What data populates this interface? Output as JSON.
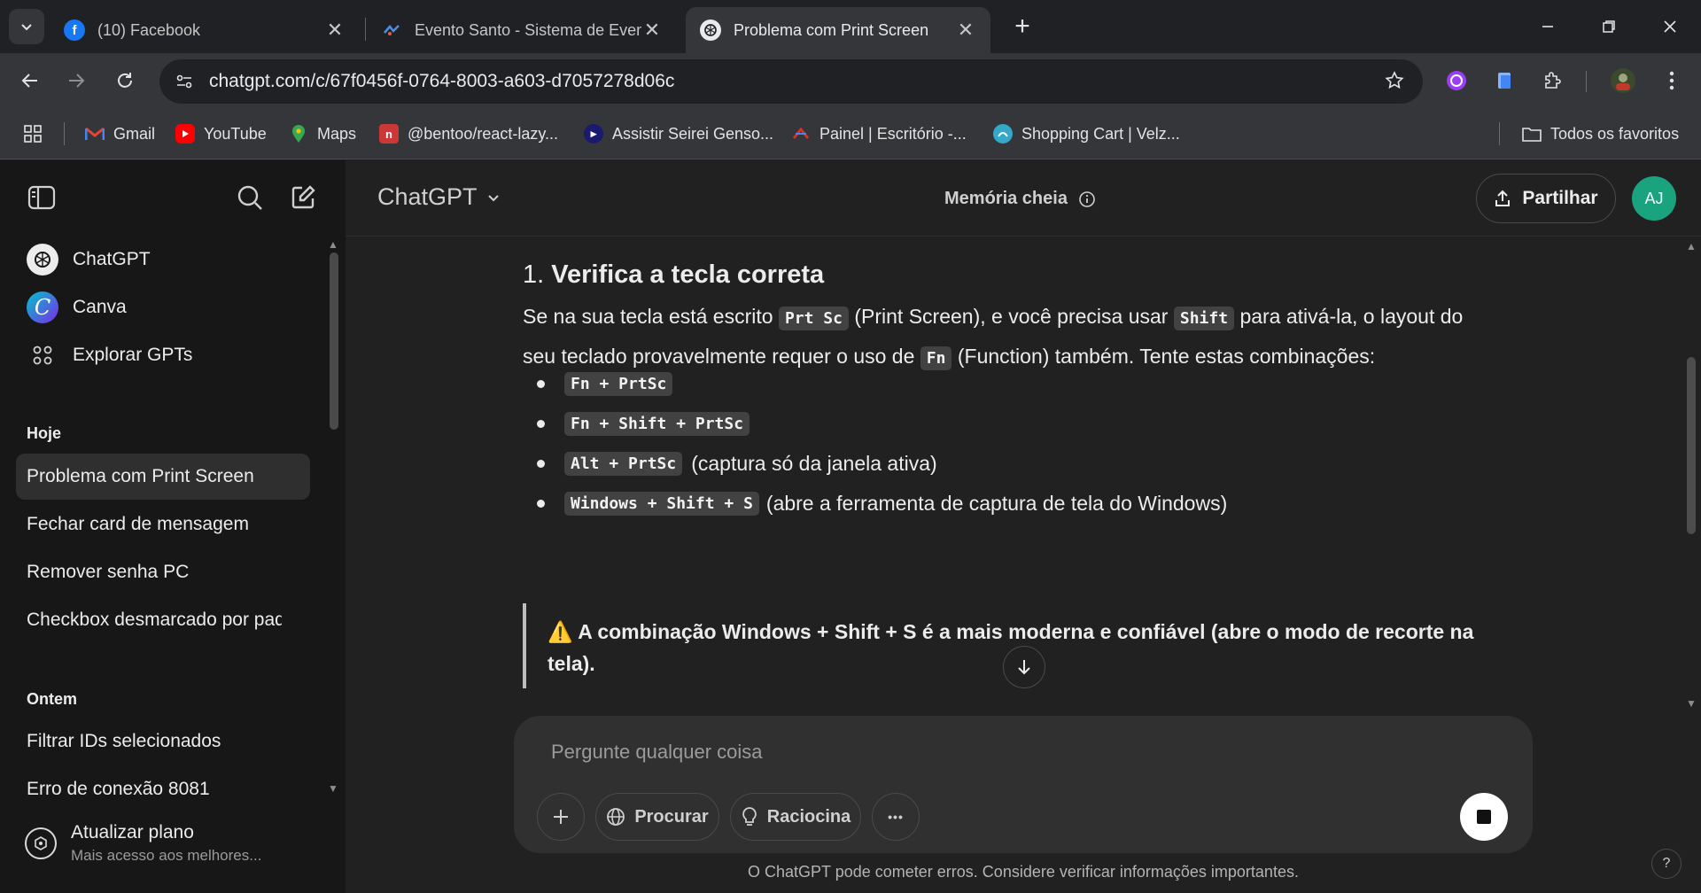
{
  "browser": {
    "tabs": [
      {
        "title": "(10) Facebook",
        "close": "✕"
      },
      {
        "title": "Evento Santo - Sistema de Even",
        "close": "✕"
      },
      {
        "title": "Problema com Print Screen",
        "close": "✕"
      }
    ],
    "new_tab": "+",
    "url": "chatgpt.com/c/67f0456f-0764-8003-a603-d7057278d06c",
    "bookmarks": [
      {
        "label": "Gmail",
        "icon": "gmail-icon",
        "color": "#ea4335"
      },
      {
        "label": "YouTube",
        "icon": "youtube-icon",
        "color": "#ff0000"
      },
      {
        "label": "Maps",
        "icon": "maps-icon",
        "color": "#34a853"
      },
      {
        "label": "@bentoo/react-lazy...",
        "icon": "npm-icon",
        "color": "#cb3837"
      },
      {
        "label": "Assistir Seirei Genso...",
        "icon": "anime-icon",
        "color": "#1a1a6e"
      },
      {
        "label": "Painel | Escritório -...",
        "icon": "painel-icon",
        "color": "#d93025"
      },
      {
        "label": "Shopping Cart | Velz...",
        "icon": "cart-icon",
        "color": "#4285f4"
      }
    ],
    "all_bookmarks": "Todos os favoritos"
  },
  "sidebar": {
    "items": [
      {
        "label": "ChatGPT",
        "icon": "openai-logo-icon"
      },
      {
        "label": "Canva",
        "icon": "canva-logo-icon"
      },
      {
        "label": "Explorar GPTs",
        "icon": "grid-icon"
      }
    ],
    "today_label": "Hoje",
    "today": [
      "Problema com Print Screen",
      "Fechar card de mensagem",
      "Remover senha PC",
      "Checkbox desmarcado por pad"
    ],
    "yesterday_label": "Ontem",
    "yesterday": [
      "Filtrar IDs selecionados",
      "Erro de conexão 8081"
    ],
    "upgrade_title": "Atualizar plano",
    "upgrade_sub": "Mais acesso aos melhores..."
  },
  "header": {
    "model": "ChatGPT",
    "memory": "Memória cheia",
    "share": "Partilhar",
    "avatar": "AJ"
  },
  "message": {
    "heading_num": "1.",
    "heading": "Verifica a tecla correta",
    "p1_a": "Se na sua tecla está escrito",
    "code_prtsc": "Prt Sc",
    "p1_b": "(Print Screen), e você precisa usar",
    "code_shift": "Shift",
    "p1_c": "para ativá-la, o layout do seu teclado provavelmente requer o uso de",
    "code_fn": "Fn",
    "p1_d": "(Function) também. Tente estas combinações:",
    "bullets": [
      {
        "code": "Fn + PrtSc",
        "text": ""
      },
      {
        "code": "Fn + Shift + PrtSc",
        "text": ""
      },
      {
        "code": "Alt + PrtSc",
        "text": "(captura só da janela ativa)"
      },
      {
        "code": "Windows + Shift + S",
        "text": "(abre a ferramenta de captura de tela do Windows)"
      }
    ],
    "quote_icon": "⚠️",
    "quote": "A combinação Windows + Shift + S é a mais moderna e confiável (abre o modo de recorte na tela)."
  },
  "composer": {
    "placeholder": "Pergunte qualquer coisa",
    "search": "Procurar",
    "reason": "Raciocina",
    "more": "•••"
  },
  "disclaimer": "O ChatGPT pode cometer erros. Considere verificar informações importantes.",
  "help": "?"
}
